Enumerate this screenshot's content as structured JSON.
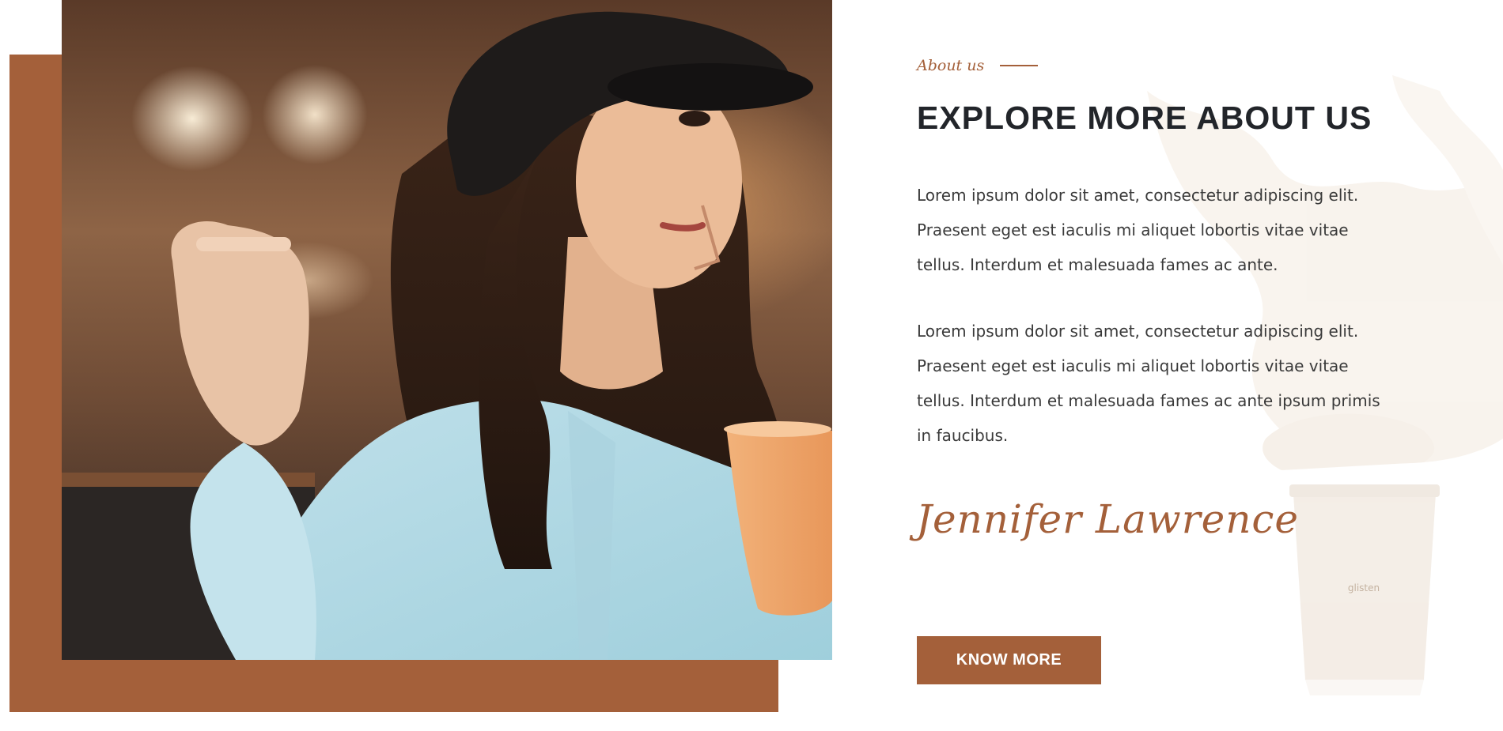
{
  "about": {
    "eyebrow": "About us",
    "title": "EXPLORE MORE ABOUT US",
    "paragraphs": [
      "Lorem ipsum dolor sit amet, consectetur adipiscing elit. Praesent eget est iaculis mi aliquet lobortis vitae vitae tellus. Interdum et malesuada fames ac ante.",
      "Lorem ipsum dolor sit amet, consectetur adipiscing elit. Praesent eget est iaculis mi aliquet lobortis vitae vitae tellus. Interdum et malesuada fames ac ante ipsum primis in faucibus."
    ],
    "signature": "Jennifer Lawrence",
    "button_label": "KNOW MORE"
  },
  "decor": {
    "cup_text": "glisten"
  },
  "colors": {
    "accent": "#a4603a",
    "title": "#22252a",
    "body_text": "#3a3a3a",
    "background": "#ffffff"
  }
}
